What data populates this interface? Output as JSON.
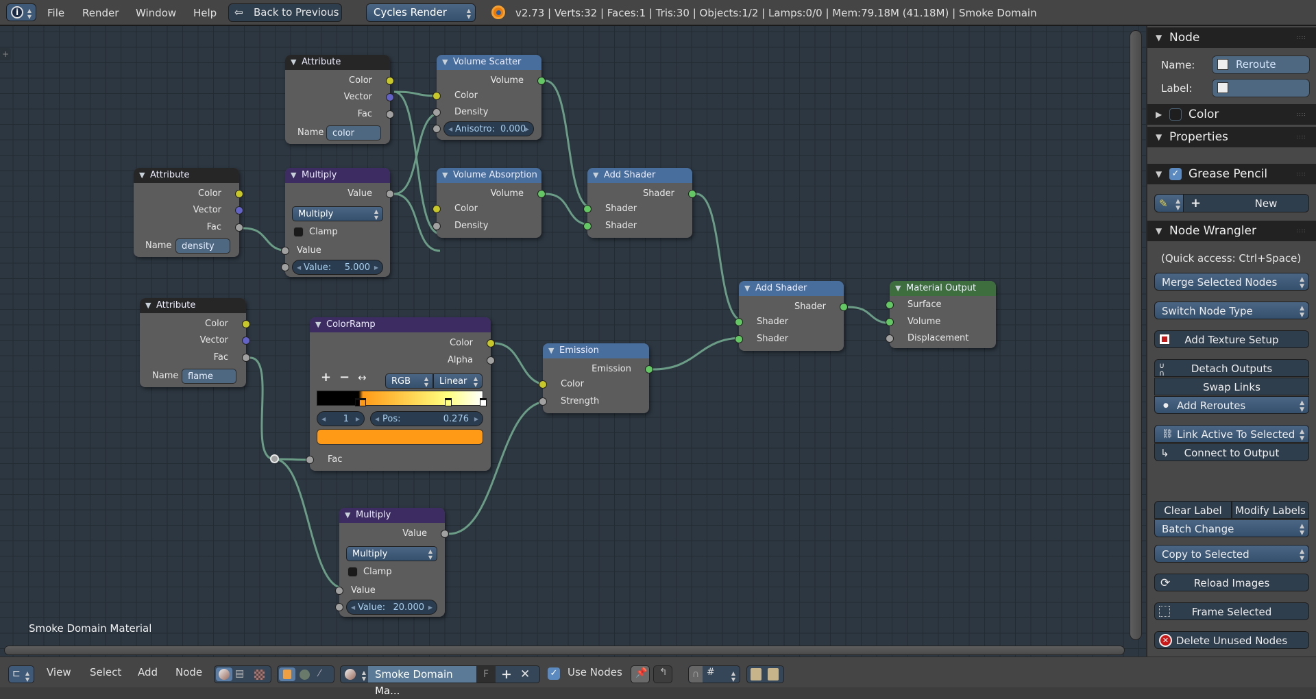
{
  "topbar": {
    "menu": [
      "File",
      "Render",
      "Window",
      "Help"
    ],
    "back_button": "Back to Previous",
    "engine": "Cycles Render",
    "stats": "v2.73 | Verts:32 | Faces:1 | Tris:30 | Objects:1/2 | Lamps:0/0 | Mem:79.18M (41.18M) | Smoke Domain"
  },
  "canvas": {
    "material_label": "Smoke Domain Material",
    "nodes": {
      "attr_color": {
        "title": "Attribute",
        "outputs": [
          "Color",
          "Vector",
          "Fac"
        ],
        "name_label": "Name",
        "name_value": "color"
      },
      "volume_scatter": {
        "title": "Volume Scatter",
        "output": "Volume",
        "inputs": [
          "Color",
          "Density"
        ],
        "anisotropy_label": "Anisotro:",
        "anisotropy_value": "0.000"
      },
      "attr_density": {
        "title": "Attribute",
        "outputs": [
          "Color",
          "Vector",
          "Fac"
        ],
        "name_label": "Name",
        "name_value": "density"
      },
      "multiply_top": {
        "title": "Multiply",
        "output": "Value",
        "operation": "Multiply",
        "clamp_label": "Clamp",
        "clamp_checked": false,
        "input": "Value",
        "value_label": "Value:",
        "value": "5.000"
      },
      "volume_absorption": {
        "title": "Volume Absorption",
        "output": "Volume",
        "inputs": [
          "Color",
          "Density"
        ]
      },
      "add_shader_top": {
        "title": "Add Shader",
        "output": "Shader",
        "inputs": [
          "Shader",
          "Shader"
        ]
      },
      "attr_flame": {
        "title": "Attribute",
        "outputs": [
          "Color",
          "Vector",
          "Fac"
        ],
        "name_label": "Name",
        "name_value": "flame"
      },
      "colorramp": {
        "title": "ColorRamp",
        "outputs": [
          "Color",
          "Alpha"
        ],
        "mode": "RGB",
        "interpolation": "Linear",
        "active_index": "1",
        "pos_label": "Pos:",
        "pos_value": "0.276",
        "input": "Fac",
        "stops": [
          {
            "pos": 0.25,
            "color": "#000000"
          },
          {
            "pos": 0.276,
            "color": "#ff9a17"
          },
          {
            "pos": 0.79,
            "color": "#ffff80"
          },
          {
            "pos": 1.0,
            "color": "#ffffff"
          }
        ],
        "active_color": "#ff9a17"
      },
      "emission": {
        "title": "Emission",
        "output": "Emission",
        "inputs": [
          "Color",
          "Strength"
        ]
      },
      "add_shader_bottom": {
        "title": "Add Shader",
        "output": "Shader",
        "inputs": [
          "Shader",
          "Shader"
        ]
      },
      "material_output": {
        "title": "Material Output",
        "inputs": [
          "Surface",
          "Volume",
          "Displacement"
        ]
      },
      "multiply_bottom": {
        "title": "Multiply",
        "output": "Value",
        "operation": "Multiply",
        "clamp_label": "Clamp",
        "clamp_checked": false,
        "input": "Value",
        "value_label": "Value:",
        "value": "20.000"
      }
    }
  },
  "sidebar": {
    "node_panel": {
      "title": "Node",
      "name_label": "Name:",
      "name_value": "Reroute",
      "label_label": "Label:",
      "label_value": ""
    },
    "color_panel": {
      "title": "Color",
      "checked": false
    },
    "properties_panel": {
      "title": "Properties"
    },
    "grease_pencil_panel": {
      "title": "Grease Pencil",
      "checked": true,
      "new_button": "New"
    },
    "node_wrangler": {
      "title": "Node Wrangler",
      "hint": "(Quick access: Ctrl+Space)",
      "merge": "Merge Selected Nodes",
      "switch": "Switch Node Type",
      "add_texture": "Add Texture Setup",
      "detach": "Detach Outputs",
      "swap": "Swap Links",
      "reroutes": "Add Reroutes",
      "link_active": "Link Active To Selected",
      "connect_output": "Connect to Output",
      "clear_label": "Clear Label",
      "modify_labels": "Modify Labels",
      "batch": "Batch Change",
      "copy": "Copy to Selected",
      "reload": "Reload Images",
      "frame": "Frame Selected",
      "delete_unused": "Delete Unused Nodes"
    }
  },
  "bottombar": {
    "menu": [
      "View",
      "Select",
      "Add",
      "Node"
    ],
    "material_name": "Smoke Domain Ma...",
    "fake_user": "F",
    "use_nodes_label": "Use Nodes",
    "use_nodes_checked": true
  }
}
